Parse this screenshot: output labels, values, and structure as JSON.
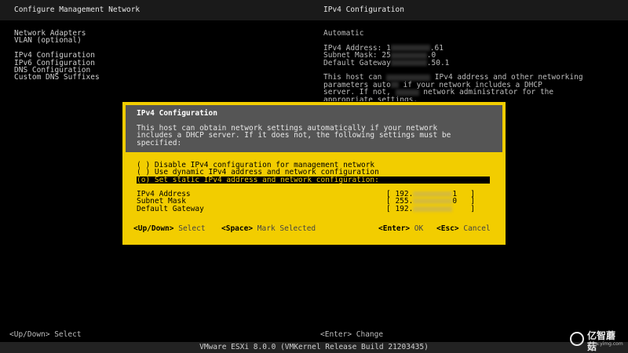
{
  "header": {
    "left_title": "Configure Management Network",
    "right_title": "IPv4 Configuration"
  },
  "menu": {
    "items": [
      "Network Adapters",
      "VLAN (optional)",
      "",
      "IPv4 Configuration",
      "IPv6 Configuration",
      "DNS Configuration",
      "Custom DNS Suffixes"
    ]
  },
  "right_pane": {
    "mode": "Automatic",
    "ipv4_prefix": "IPv4 Address: 1",
    "ipv4_suffix": ".61",
    "mask_prefix": "Subnet Mask: 25",
    "mask_suffix": ".0",
    "gateway_prefix": "Default Gateway",
    "gateway_suffix": ".50.1",
    "desc_line1a": "This host can ",
    "desc_line1b": " IPv4 address and other networking",
    "desc_line2a": "parameters auto",
    "desc_line2b": " if your network includes a DHCP",
    "desc_line3a": "server. If not, ",
    "desc_line3b": " network administrator for the",
    "desc_line4": "appropriate settings."
  },
  "dialog": {
    "title": "IPv4 Configuration",
    "desc_line1": "This host can obtain network settings automatically if your network",
    "desc_line2": "includes a DHCP server. If it does not, the following settings must be",
    "desc_line3": "specified:",
    "options": [
      "( ) Disable IPv4 configuration for management network",
      "( ) Use dynamic IPv4 address and network configuration",
      "(o) Set static IPv4 address and network configuration:"
    ],
    "fields": {
      "ipv4_label": "IPv4 Address",
      "ipv4_prefix": "[ 192.",
      "ipv4_suffix": "1   ]",
      "mask_label": "Subnet Mask",
      "mask_prefix": "[ 255.",
      "mask_suffix": "0   ]",
      "gateway_label": "Default Gateway",
      "gateway_prefix": "[ 192.",
      "gateway_suffix": "    ]"
    },
    "footer": {
      "updown_key": "<Up/Down>",
      "updown_action": "Select",
      "space_key": "<Space>",
      "space_action": "Mark Selected",
      "enter_key": "<Enter>",
      "enter_action": "OK",
      "esc_key": "<Esc>",
      "esc_action": "Cancel"
    }
  },
  "bottom": {
    "left_hint": "<Up/Down> Select",
    "mid_hint": "<Enter> Change",
    "footer": "VMware ESXi 8.0.0 (VMKernel Release Build 21203435)"
  },
  "watermark": {
    "text": "亿智蘑菇",
    "sub": "www.yimg.com"
  }
}
